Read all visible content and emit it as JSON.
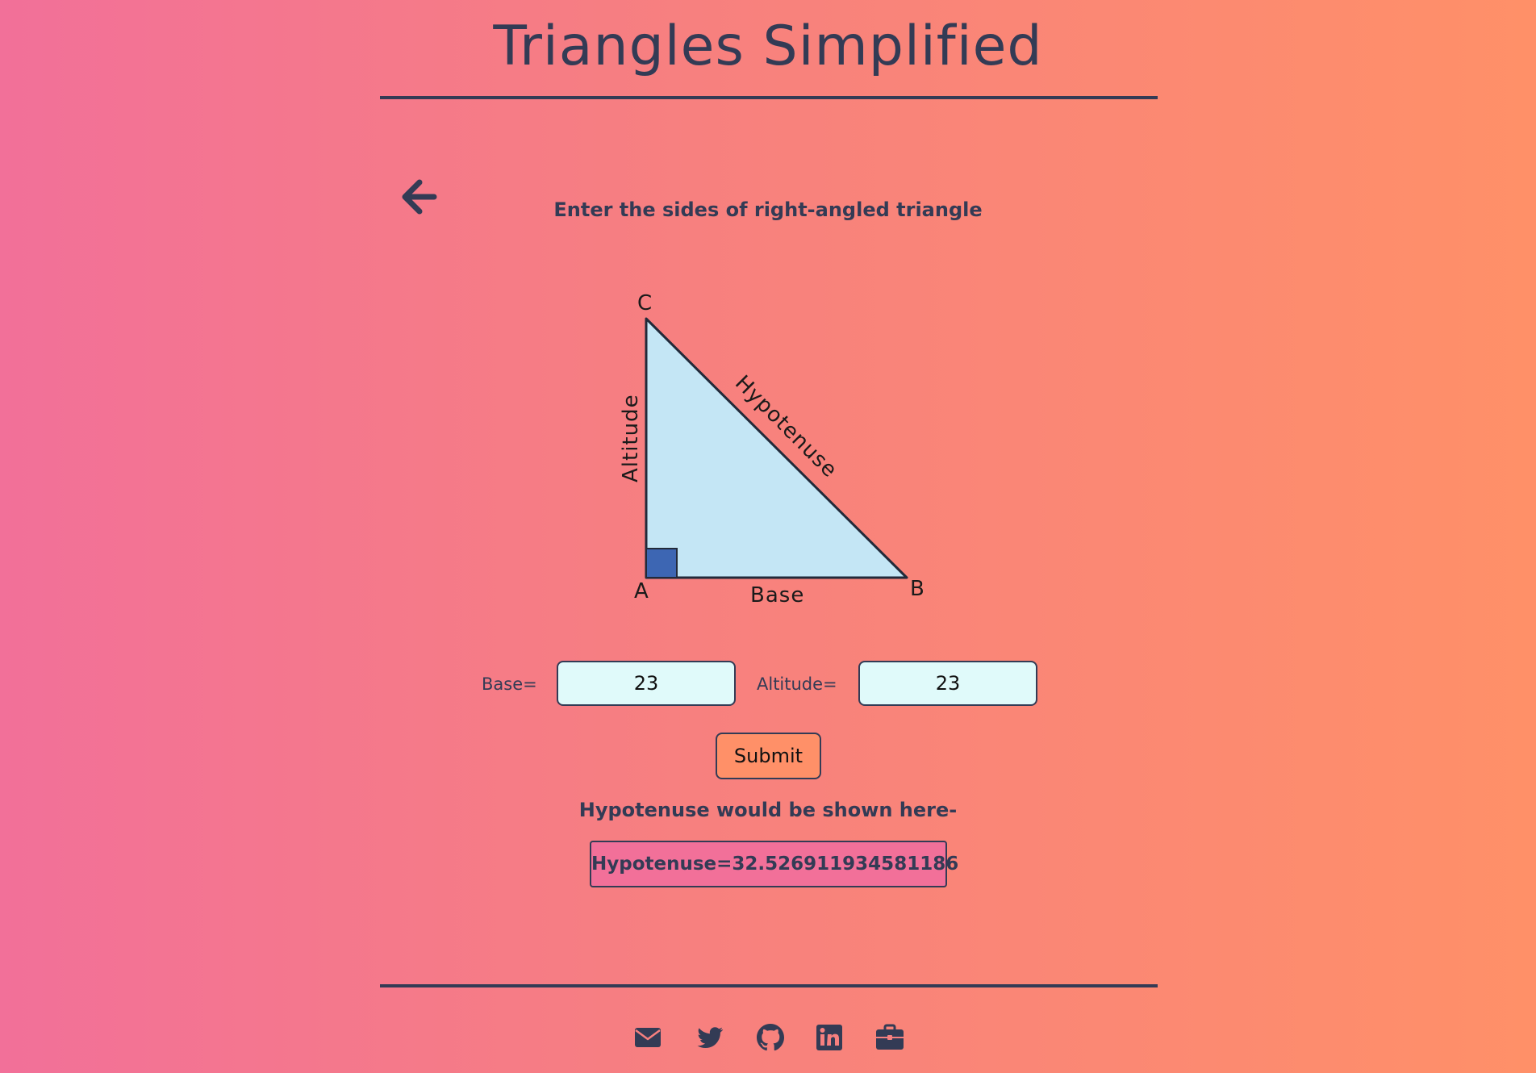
{
  "header": {
    "title": "Triangles Simplified"
  },
  "prompt": "Enter the sides of right-angled triangle",
  "figure": {
    "vertex_c": "C",
    "vertex_a": "A",
    "vertex_b": "B",
    "altitude_label": "Altitude",
    "hypotenuse_label": "Hypotenuse",
    "base_label": "Base"
  },
  "form": {
    "base_label": "Base=",
    "base_value": "23",
    "altitude_label": "Altitude=",
    "altitude_value": "23",
    "submit_label": "Submit"
  },
  "result": {
    "caption": "Hypotenuse would be shown here-",
    "output": "Hypotenuse=32.526911934581186"
  },
  "footer": {
    "icons": [
      "envelope-icon",
      "twitter-icon",
      "github-icon",
      "linkedin-icon",
      "briefcase-icon"
    ]
  },
  "colors": {
    "text": "#333b55",
    "triangle_fill": "#c4e6f5",
    "right_angle_marker": "#3d66b3",
    "input_bg": "#e0fafa",
    "button_bg": "#ff9068",
    "result_bg": "#f27099"
  }
}
